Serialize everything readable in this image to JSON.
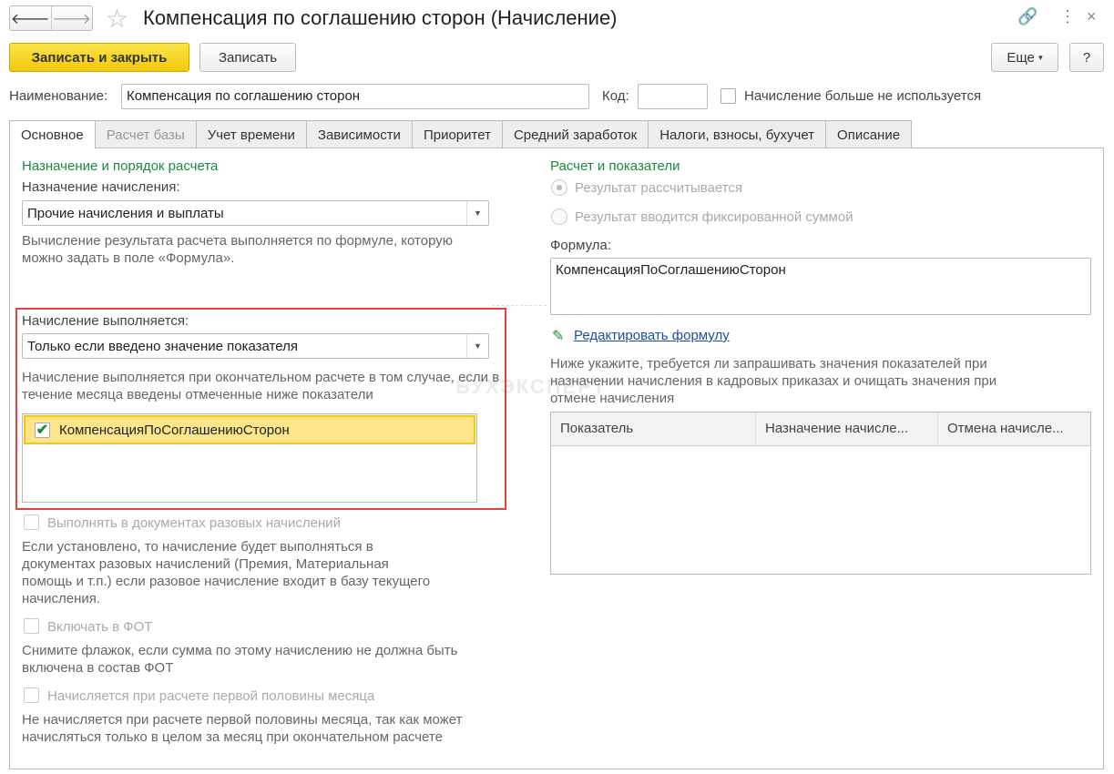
{
  "header": {
    "title": "Компенсация по соглашению сторон (Начисление)",
    "back": "🡐",
    "forward": "🡒"
  },
  "toolbar": {
    "save_close": "Записать и закрыть",
    "save": "Записать",
    "more": "Еще",
    "help": "?"
  },
  "fields": {
    "name_label": "Наименование:",
    "name_value": "Компенсация по соглашению сторон",
    "code_label": "Код:",
    "code_value": "",
    "unused_label": "Начисление больше не используется"
  },
  "tabs": [
    "Основное",
    "Расчет базы",
    "Учет времени",
    "Зависимости",
    "Приоритет",
    "Средний заработок",
    "Налоги, взносы, бухучет",
    "Описание"
  ],
  "left": {
    "section_title": "Назначение и порядок расчета",
    "purpose_label": "Назначение начисления:",
    "purpose_value": "Прочие начисления и выплаты",
    "purpose_hint": "Вычисление результата расчета выполняется по формуле, которую можно задать в поле «Формула».",
    "exec_label": "Начисление выполняется:",
    "exec_value": "Только если введено значение показателя",
    "exec_hint": "Начисление выполняется при окончательном расчете в том случае, если в течение месяца введены отмеченные ниже показатели",
    "indicator": "КомпенсацияПоСоглашениюСторон",
    "opt1_label": "Выполнять в документах разовых начислений",
    "opt1_hint": "Если установлено, то начисление будет выполняться в документах разовых начислений (Премия, Материальная помощь и т.п.) если разовое начисление входит в базу текущего начисления.",
    "opt2_label": "Включать в ФОТ",
    "opt2_hint": "Снимите флажок, если сумма по этому начислению не должна быть включена в состав ФОТ",
    "opt3_label": "Начисляется при расчете первой половины месяца",
    "opt3_hint": "Не начисляется при расчете первой половины месяца, так как может начисляться только в целом за месяц при окончательном расчете"
  },
  "right": {
    "section_title": "Расчет и показатели",
    "radio1": "Результат рассчитывается",
    "radio2": "Результат вводится фиксированной суммой",
    "formula_label": "Формула:",
    "formula_value": "КомпенсацияПоСоглашениюСторон",
    "edit_formula": "Редактировать формулу",
    "hint": "Ниже укажите, требуется ли запрашивать значения показателей при назначении начисления в кадровых приказах и очищать значения при отмене начисления",
    "columns": [
      "Показатель",
      "Назначение начисле...",
      "Отмена начисле..."
    ]
  },
  "watermark": "БУХЭКСПЕРТ",
  "colors": {
    "accent_green": "#1b8a3e",
    "highlight": "#e8413e",
    "selection": "#fde68a",
    "primary": "#f2c80a"
  }
}
